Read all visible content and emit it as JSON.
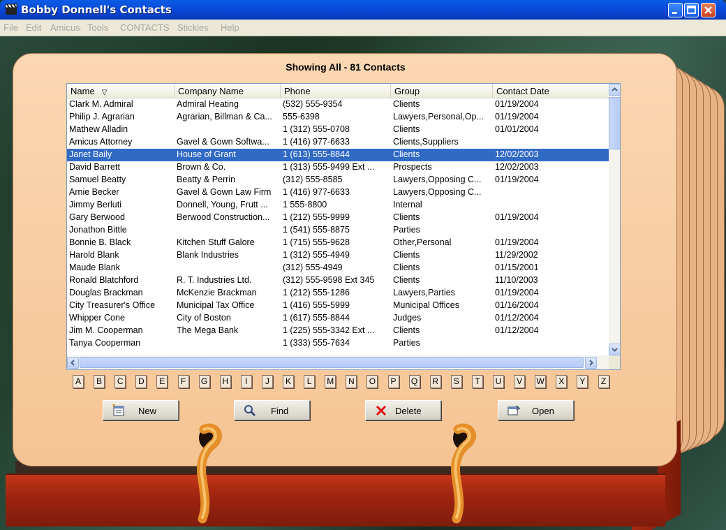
{
  "window": {
    "title": "Bobby Donnell's Contacts"
  },
  "menu": [
    {
      "label": "File"
    },
    {
      "label": "Edit"
    },
    {
      "label": "Amicus"
    },
    {
      "label": "Tools"
    },
    {
      "label": "CONTACTS"
    },
    {
      "label": "Stickies"
    },
    {
      "label": "Help"
    }
  ],
  "heading": "Showing All - 81 Contacts",
  "columns": [
    {
      "label": "Name"
    },
    {
      "label": "Company Name"
    },
    {
      "label": "Phone"
    },
    {
      "label": "Group"
    },
    {
      "label": "Contact Date"
    }
  ],
  "sort_indicator": "▽",
  "contacts": [
    {
      "name": "Clark M. Admiral",
      "company": "Admiral Heating",
      "phone": "(532) 555-9354",
      "group": "Clients",
      "date": "01/19/2004"
    },
    {
      "name": "Philip J. Agrarian",
      "company": "Agrarian, Billman & Ca...",
      "phone": "555-6398",
      "group": "Lawyers,Personal,Op...",
      "date": "01/19/2004"
    },
    {
      "name": "Mathew Alladin",
      "company": "",
      "phone": "1 (312) 555-0708",
      "group": "Clients",
      "date": "01/01/2004"
    },
    {
      "name": "Amicus Attorney",
      "company": "Gavel & Gown Softwa...",
      "phone": "1 (416) 977-6633",
      "group": "Clients,Suppliers",
      "date": ""
    },
    {
      "name": "Janet Baily",
      "company": "House of Grant",
      "phone": "1 (613) 555-8844",
      "group": "Clients",
      "date": "12/02/2003",
      "selected": true
    },
    {
      "name": "David Barrett",
      "company": "Brown & Co.",
      "phone": "1 (313) 555-9499 Ext ...",
      "group": "Prospects",
      "date": "12/02/2003"
    },
    {
      "name": "Samuel Beatty",
      "company": "Beatty & Perrin",
      "phone": "(312) 555-8585",
      "group": "Lawyers,Opposing C...",
      "date": "01/19/2004"
    },
    {
      "name": "Arnie Becker",
      "company": "Gavel & Gown Law Firm",
      "phone": "1 (416) 977-6633",
      "group": "Lawyers,Opposing C...",
      "date": ""
    },
    {
      "name": "Jimmy Berluti",
      "company": "Donnell, Young, Frutt ...",
      "phone": "1 555-8800",
      "group": "Internal",
      "date": ""
    },
    {
      "name": "Gary Berwood",
      "company": "Berwood Construction...",
      "phone": "1 (212) 555-9999",
      "group": "Clients",
      "date": "01/19/2004"
    },
    {
      "name": "Jonathon Bittle",
      "company": "",
      "phone": "1 (541) 555-8875",
      "group": "Parties",
      "date": ""
    },
    {
      "name": "Bonnie B. Black",
      "company": "Kitchen Stuff Galore",
      "phone": "1 (715) 555-9628",
      "group": "Other,Personal",
      "date": "01/19/2004"
    },
    {
      "name": "Harold Blank",
      "company": "Blank Industries",
      "phone": "1 (312) 555-4949",
      "group": "Clients",
      "date": "11/29/2002"
    },
    {
      "name": "Maude Blank",
      "company": "",
      "phone": "(312) 555-4949",
      "group": "Clients",
      "date": "01/15/2001"
    },
    {
      "name": "Ronald Blatchford",
      "company": "R. T. Industries Ltd.",
      "phone": "(312) 555-9598 Ext 345",
      "group": "Clients",
      "date": "11/10/2003"
    },
    {
      "name": "Douglas Brackman",
      "company": "McKenzie Brackman",
      "phone": "1 (212) 555-1286",
      "group": "Lawyers,Parties",
      "date": "01/19/2004"
    },
    {
      "name": "City Treasurer's Office",
      "company": "Municipal Tax Office",
      "phone": "1 (416) 555-5999",
      "group": "Municipal Offices",
      "date": "01/16/2004"
    },
    {
      "name": "Whipper Cone",
      "company": "City of Boston",
      "phone": "1 (617) 555-8844",
      "group": "Judges",
      "date": "01/12/2004"
    },
    {
      "name": "Jim M. Cooperman",
      "company": "The Mega Bank",
      "phone": "1 (225) 555-3342 Ext ...",
      "group": "Clients",
      "date": "01/12/2004"
    },
    {
      "name": "Tanya Cooperman",
      "company": "",
      "phone": "1 (333) 555-7634",
      "group": "Parties",
      "date": ""
    }
  ],
  "alphabet": [
    "A",
    "B",
    "C",
    "D",
    "E",
    "F",
    "G",
    "H",
    "I",
    "J",
    "K",
    "L",
    "M",
    "N",
    "O",
    "P",
    "Q",
    "R",
    "S",
    "T",
    "U",
    "V",
    "W",
    "X",
    "Y",
    "Z"
  ],
  "buttons": {
    "new": "New",
    "find": "Find",
    "delete": "Delete",
    "open": "Open"
  },
  "colors": {
    "selection": "#316ac5",
    "card": "#f8cda3",
    "base": "#a6280f"
  }
}
